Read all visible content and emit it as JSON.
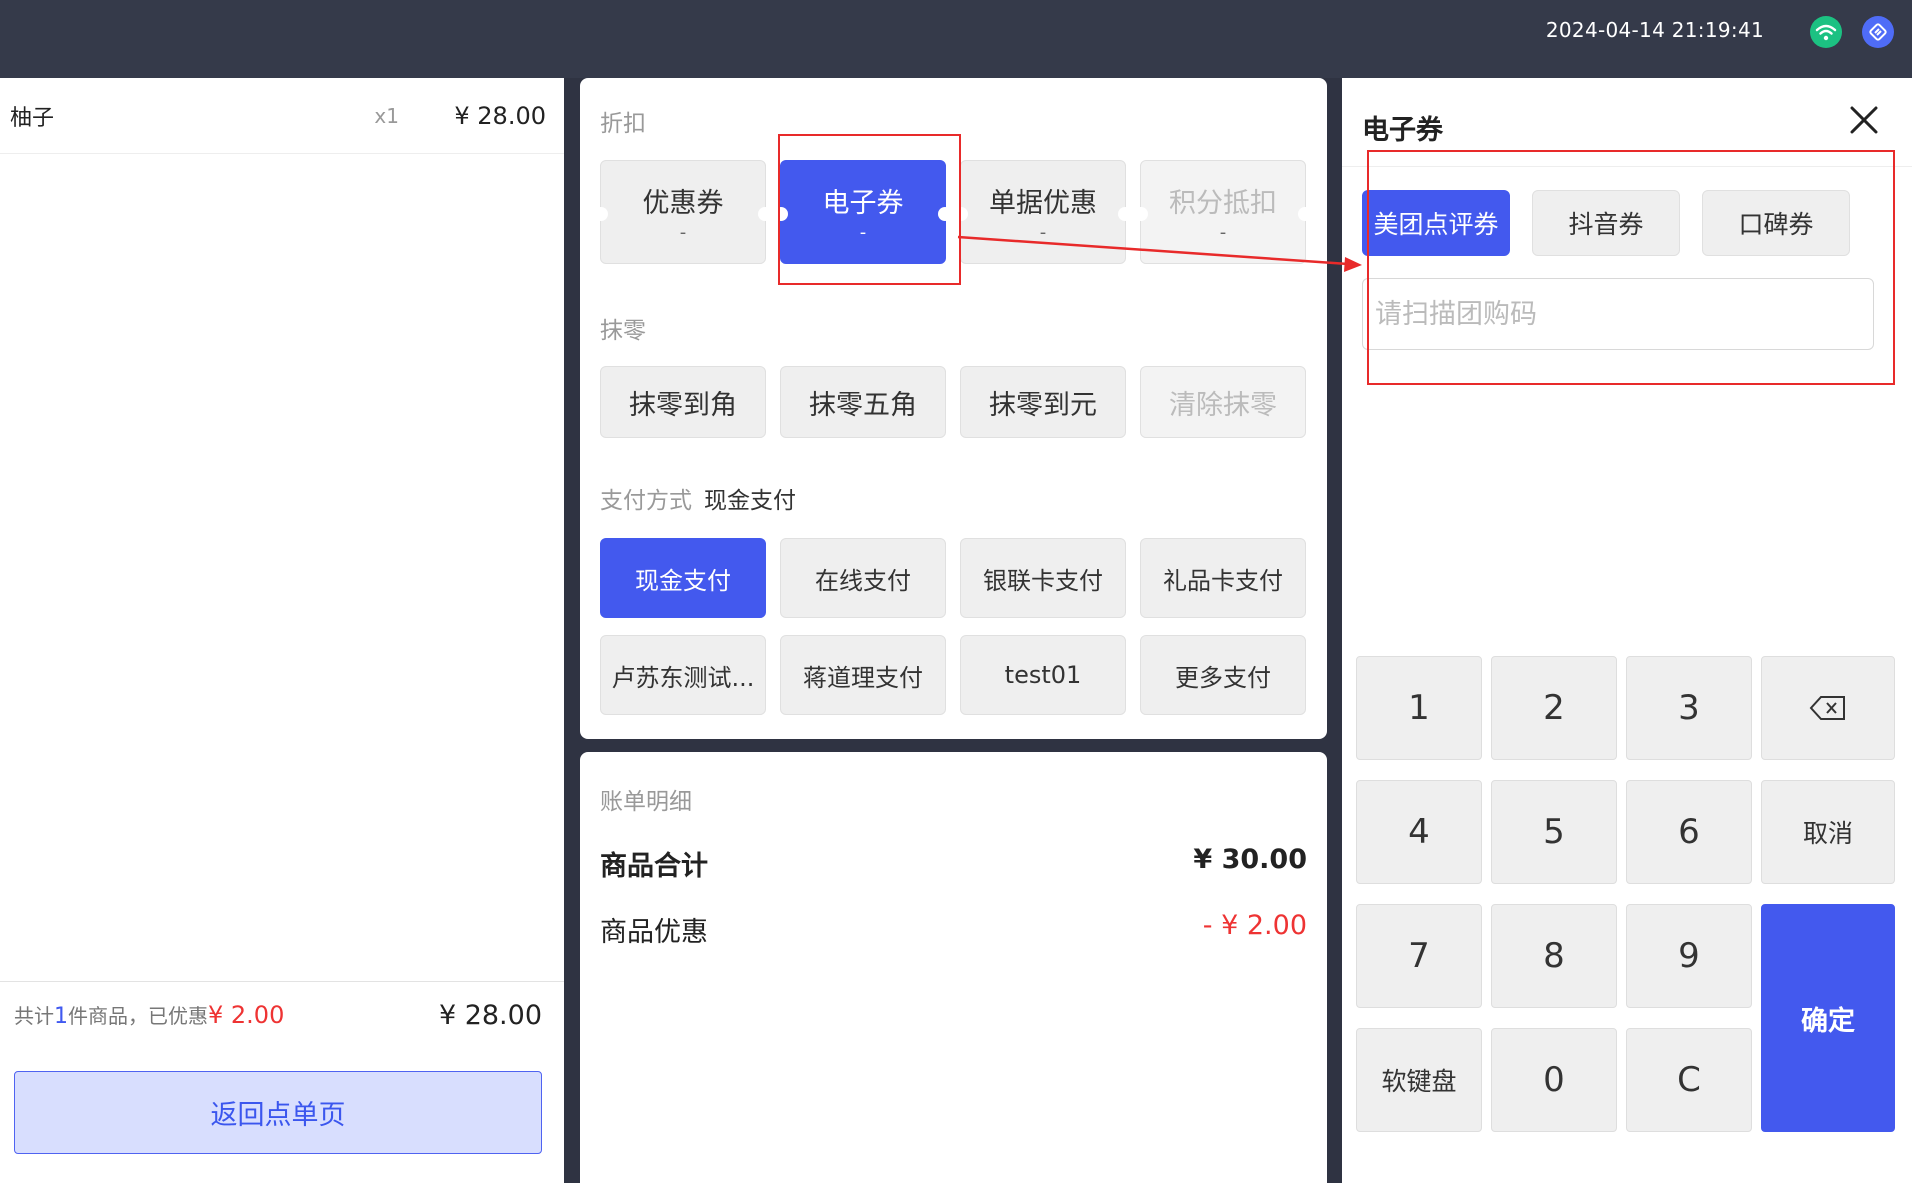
{
  "topbar": {
    "datetime": "2024-04-14 21:19:41"
  },
  "cart": {
    "items": [
      {
        "name": "柚子",
        "qty": "x1",
        "price": "¥ 28.00"
      }
    ],
    "summary_prefix": "共计",
    "summary_count": "1",
    "summary_middle": "件商品，已优惠",
    "summary_discount": "¥ 2.00",
    "total": "¥ 28.00",
    "back_label": "返回点单页"
  },
  "discount": {
    "label": "折扣",
    "buttons": [
      {
        "label": "优惠券",
        "sub": "-"
      },
      {
        "label": "电子券",
        "sub": "-"
      },
      {
        "label": "单据优惠",
        "sub": "-"
      },
      {
        "label": "积分抵扣",
        "sub": "-"
      }
    ]
  },
  "rounding": {
    "label": "抹零",
    "buttons": [
      "抹零到角",
      "抹零五角",
      "抹零到元",
      "清除抹零"
    ]
  },
  "payment": {
    "label": "支付方式",
    "current": "现金支付",
    "buttons": [
      "现金支付",
      "在线支付",
      "银联卡支付",
      "礼品卡支付",
      "卢苏东测试...",
      "蒋道理支付",
      "test01",
      "更多支付"
    ]
  },
  "bill": {
    "label": "账单明细",
    "subtotal_label": "商品合计",
    "subtotal_value": "¥ 30.00",
    "discount_label": "商品优惠",
    "discount_value": "- ¥ 2.00"
  },
  "voucher": {
    "title": "电子券",
    "tabs": [
      "美团点评券",
      "抖音券",
      "口碑券"
    ],
    "input_placeholder": "请扫描团购码",
    "keys": {
      "k1": "1",
      "k2": "2",
      "k3": "3",
      "k4": "4",
      "k5": "5",
      "k6": "6",
      "k7": "7",
      "k8": "8",
      "k9": "9",
      "k0": "0",
      "clear": "C",
      "cancel": "取消",
      "confirm": "确定",
      "soft_keyboard": "软键盘"
    }
  },
  "colors": {
    "accent": "#4359ee",
    "annotation": "#e82a2a",
    "topbar": "#353a4a"
  }
}
